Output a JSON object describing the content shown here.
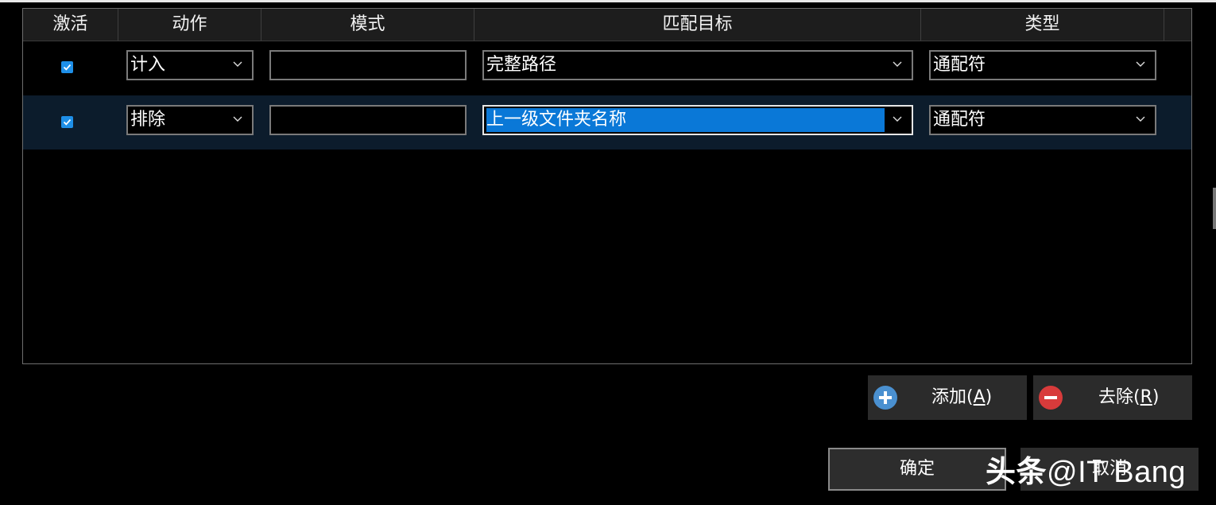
{
  "columns": [
    {
      "label": "激活"
    },
    {
      "label": "动作"
    },
    {
      "label": "模式"
    },
    {
      "label": "匹配目标"
    },
    {
      "label": "类型"
    }
  ],
  "rows": [
    {
      "active": true,
      "action": "计入",
      "pattern": "",
      "target": "完整路径",
      "type": "通配符",
      "selected": false
    },
    {
      "active": true,
      "action": "排除",
      "pattern": "",
      "target": "上一级文件夹名称",
      "type": "通配符",
      "selected": true
    }
  ],
  "buttons": {
    "add": {
      "label": "添加",
      "mnemonic": "A",
      "icon": "plus-circle-icon",
      "color": "#4a90d0"
    },
    "remove": {
      "label": "去除",
      "mnemonic": "R",
      "icon": "minus-circle-icon",
      "color": "#d83b3b"
    },
    "ok": "确定",
    "cancel": "取消"
  },
  "watermark": {
    "brand": "头条",
    "handle": "@IT Bang"
  },
  "colors": {
    "accent": "#0a78d7",
    "checkbox": "#1e8fe8",
    "selected_row": "#0c1c2c",
    "header": "#1d1d1d"
  }
}
